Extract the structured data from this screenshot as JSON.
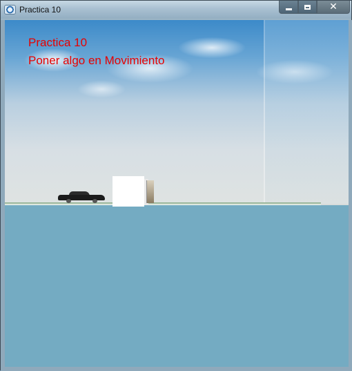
{
  "window": {
    "title": "Practica 10",
    "controls": {
      "minimize": "minimize",
      "maximize": "maximize",
      "close": "close"
    }
  },
  "scene": {
    "overlay_lines": [
      "Practica 10",
      "Poner algo en Movimiento"
    ],
    "text_color": "#e60000",
    "objects": [
      "car",
      "white-cube",
      "sign-post"
    ]
  },
  "icons": {
    "app": "app-icon",
    "minimize": "minimize-icon",
    "maximize": "maximize-icon",
    "close": "close-icon"
  }
}
